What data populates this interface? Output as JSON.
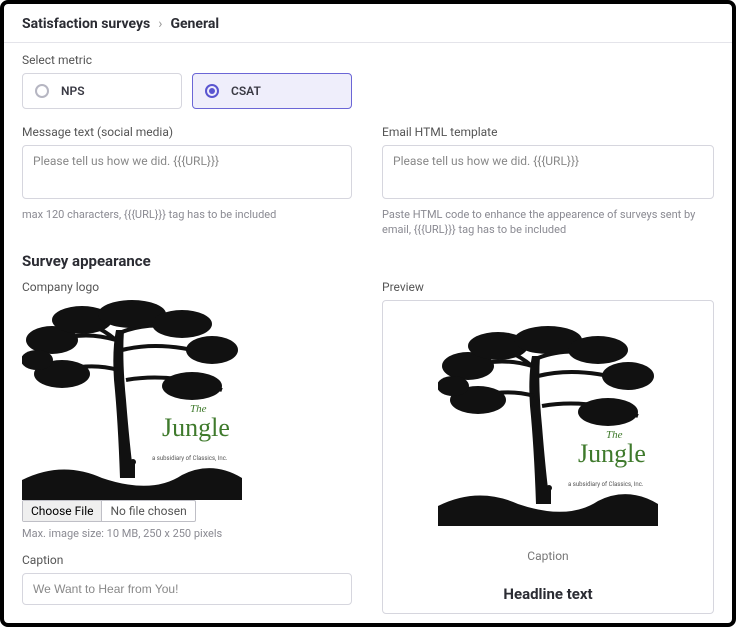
{
  "breadcrumb": {
    "root": "Satisfaction surveys",
    "current": "General"
  },
  "metric": {
    "label": "Select metric",
    "options": [
      {
        "value": "NPS",
        "selected": false
      },
      {
        "value": "CSAT",
        "selected": true
      }
    ]
  },
  "message": {
    "label": "Message text (social media)",
    "value": "Please tell us how we did. {{{URL}}}",
    "help": "max 120 characters, {{{URL}}} tag has to be included"
  },
  "emailTemplate": {
    "label": "Email HTML template",
    "value": "Please tell us how we did. {{{URL}}}",
    "help": "Paste HTML code to enhance the appearence of surveys sent by email, {{{URL}}} tag has to be included"
  },
  "appearance": {
    "heading": "Survey appearance",
    "logo": {
      "label": "Company logo",
      "file_button": "Choose File",
      "file_status": "No file chosen",
      "help": "Max. image size: 10 MB, 250 x 250 pixels",
      "image_text_top": "The",
      "image_text_main": "Jungle",
      "image_subtext": "a subsidiary of Classics, Inc."
    },
    "caption": {
      "label": "Caption",
      "value": "We Want to Hear from You!"
    },
    "preview": {
      "label": "Preview",
      "caption": "Caption",
      "headline": "Headline text"
    }
  }
}
